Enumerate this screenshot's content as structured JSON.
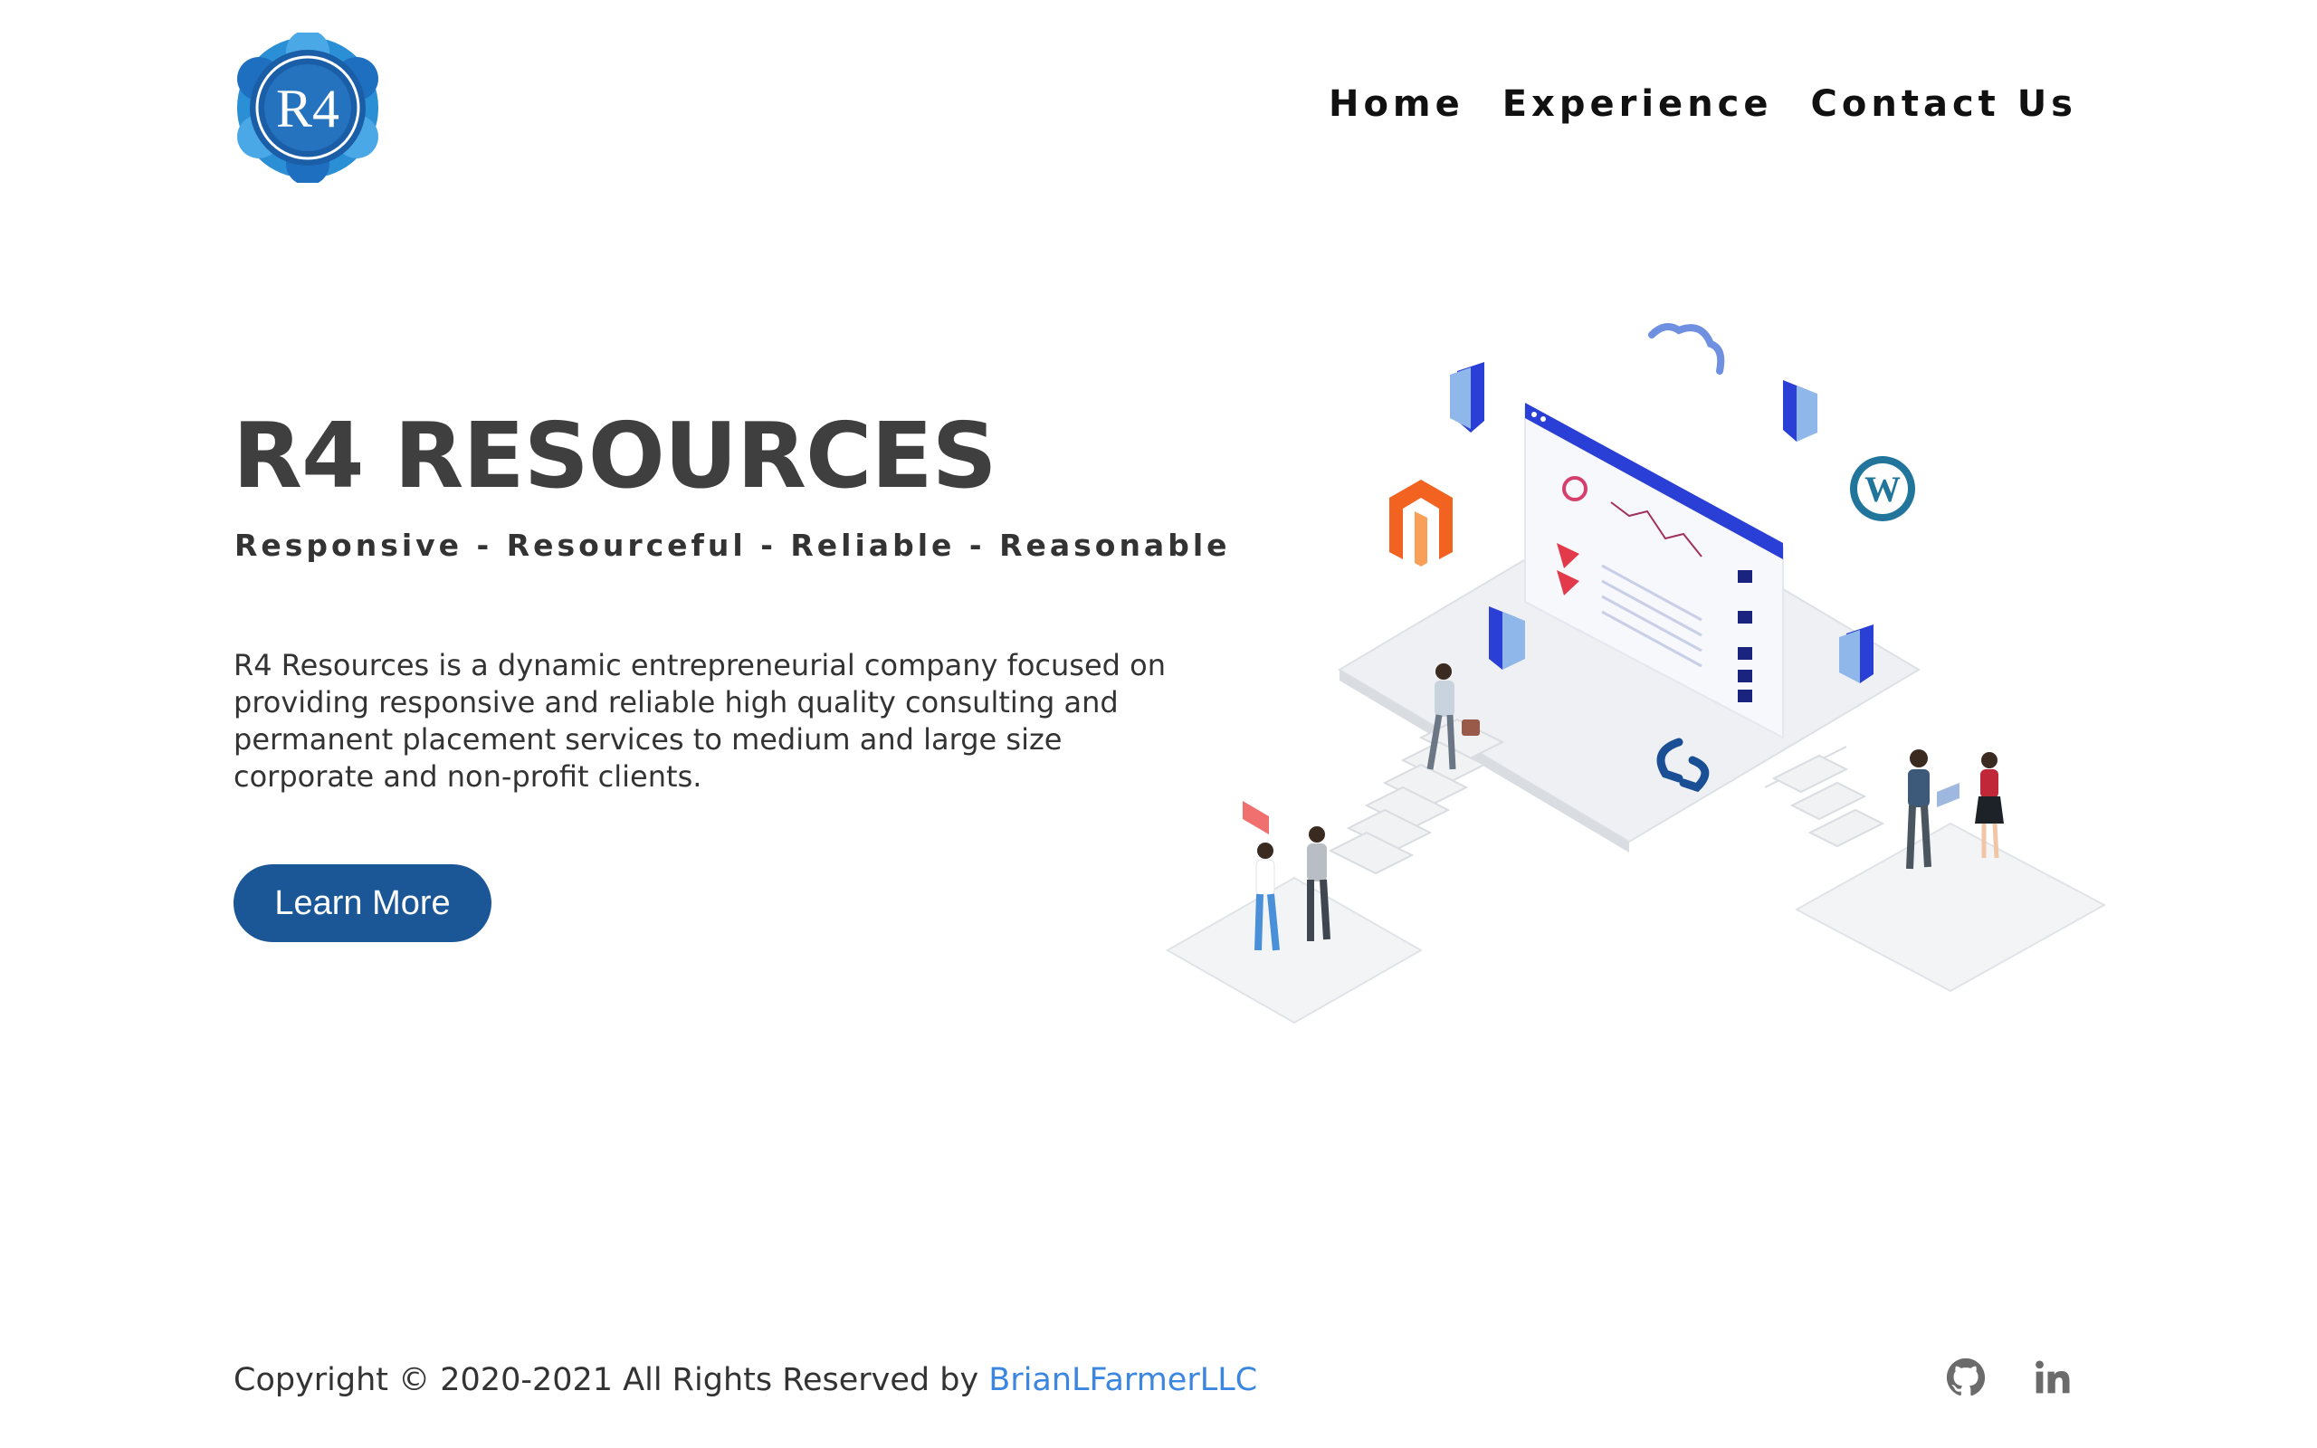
{
  "logo": {
    "text": "R4"
  },
  "nav": {
    "items": [
      {
        "label": "Home"
      },
      {
        "label": "Experience"
      },
      {
        "label": "Contact Us"
      }
    ]
  },
  "hero": {
    "title": "R4 RESOURCES",
    "tagline": "Responsive - Resourceful - Reliable - Reasonable",
    "description": "R4 Resources is a dynamic entrepreneurial company focused on providing responsive and reliable high quality consulting and permanent placement services to medium and large size corporate and non-profit clients.",
    "cta_label": "Learn More"
  },
  "footer": {
    "copyright_prefix": "Copyright © 2020-2021 All Rights Reserved by ",
    "owner_link": "BrianLFarmerLLC"
  },
  "colors": {
    "primary_button": "#1b5797",
    "link": "#3a86e0",
    "title": "#3f3f3f",
    "screen_header": "#2a3fd6"
  },
  "icons": [
    "r4-logo-icon",
    "github-icon",
    "linkedin-icon",
    "shield-icon",
    "cloud-icon",
    "wordpress-icon",
    "magento-icon",
    "sync-icon"
  ]
}
